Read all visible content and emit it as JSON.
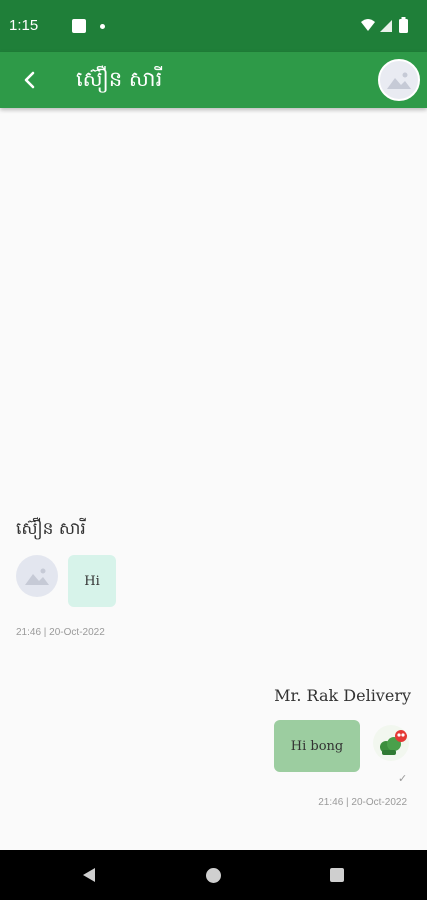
{
  "status_bar": {
    "time": "1:15"
  },
  "header": {
    "title": "ស៊ឿន សារី"
  },
  "messages": {
    "incoming": {
      "sender": "ស៊ឿន សារី",
      "text": "Hi",
      "time": "21:46 | 20-Oct-2022"
    },
    "outgoing": {
      "sender": "Mr. Rak Delivery",
      "text": "Hi bong",
      "time": "21:46 | 20-Oct-2022",
      "status": "✓"
    }
  },
  "colors": {
    "status_bar": "#1f7f39",
    "app_bar": "#2e9a48",
    "incoming_bubble": "#d7f3ea",
    "outgoing_bubble": "#9ccda0"
  }
}
